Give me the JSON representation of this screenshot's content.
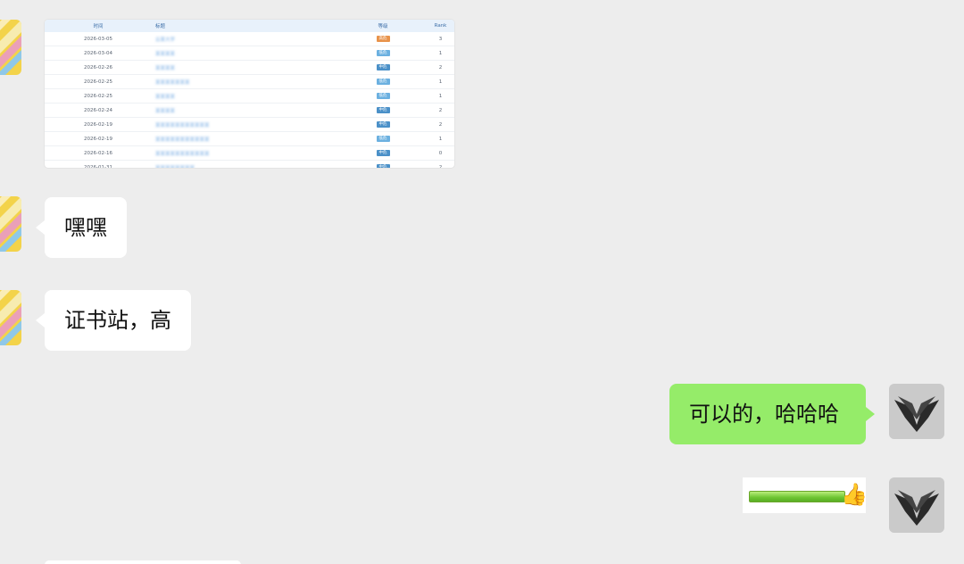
{
  "image_message": {
    "table": {
      "headers": [
        "时间",
        "标题",
        "等级",
        "Rank"
      ],
      "rows": [
        {
          "date": "2026-03-05",
          "title": "云某大学",
          "tag": "高危",
          "tag_color": "#e8924a",
          "rank": "3"
        },
        {
          "date": "2026-03-04",
          "title": "某某某某",
          "tag": "低危",
          "tag_color": "#6bb0e0",
          "rank": "1"
        },
        {
          "date": "2026-02-26",
          "title": "某某某某",
          "tag": "中危",
          "tag_color": "#4a90c8",
          "rank": "2"
        },
        {
          "date": "2026-02-25",
          "title": "某某某某某某某",
          "tag": "低危",
          "tag_color": "#6bb0e0",
          "rank": "1"
        },
        {
          "date": "2026-02-25",
          "title": "某某某某",
          "tag": "低危",
          "tag_color": "#6bb0e0",
          "rank": "1"
        },
        {
          "date": "2026-02-24",
          "title": "某某某某",
          "tag": "中危",
          "tag_color": "#4a90c8",
          "rank": "2"
        },
        {
          "date": "2026-02-19",
          "title": "某某某某某某某某某某某",
          "tag": "中危",
          "tag_color": "#4a90c8",
          "rank": "2"
        },
        {
          "date": "2026-02-19",
          "title": "某某某某某某某某某某某",
          "tag": "低危",
          "tag_color": "#6bb0e0",
          "rank": "1"
        },
        {
          "date": "2026-02-16",
          "title": "某某某某某某某某某某某",
          "tag": "中危",
          "tag_color": "#4a90c8",
          "rank": "0"
        },
        {
          "date": "2026-01-31",
          "title": "某某某某某某某某",
          "tag": "中危",
          "tag_color": "#4a90c8",
          "rank": "2"
        }
      ]
    }
  },
  "messages": {
    "m1": "嘿嘿",
    "m2": "证书站，高",
    "m3": "可以的，哈哈哈"
  },
  "sticker": {
    "icon": "thumbs-up-icon",
    "glyph": "👍"
  },
  "colors": {
    "background": "#ededed",
    "incoming_bubble": "#ffffff",
    "outgoing_bubble": "#95ec69"
  }
}
